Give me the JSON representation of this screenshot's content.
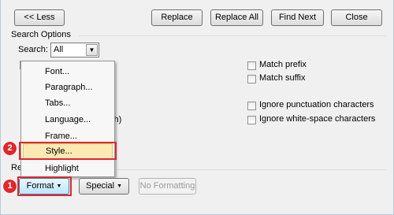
{
  "top_buttons": {
    "less": "<< Less",
    "replace": "Replace",
    "replace_all": "Replace All",
    "find_next": "Find Next",
    "close": "Close"
  },
  "search_options": {
    "group_label": "Search Options",
    "search_label": "Search:",
    "search_value": "All"
  },
  "right_options": {
    "match_prefix": "Match prefix",
    "match_suffix": "Match suffix",
    "ignore_punctuation": "Ignore punctuation characters",
    "ignore_whitespace": "Ignore white-space characters"
  },
  "hidden_fragments": {
    "left_text": "sh)",
    "replace_label": "Re"
  },
  "format_menu": {
    "items": [
      "Font...",
      "Paragraph...",
      "Tabs...",
      "Language...",
      "Frame...",
      "Style...",
      "Highlight"
    ],
    "highlighted_index": 5
  },
  "bottom_buttons": {
    "format": "Format",
    "special": "Special",
    "no_formatting": "No Formatting"
  },
  "annotations": {
    "step1": "1",
    "step2": "2",
    "color": "#e1272c"
  }
}
